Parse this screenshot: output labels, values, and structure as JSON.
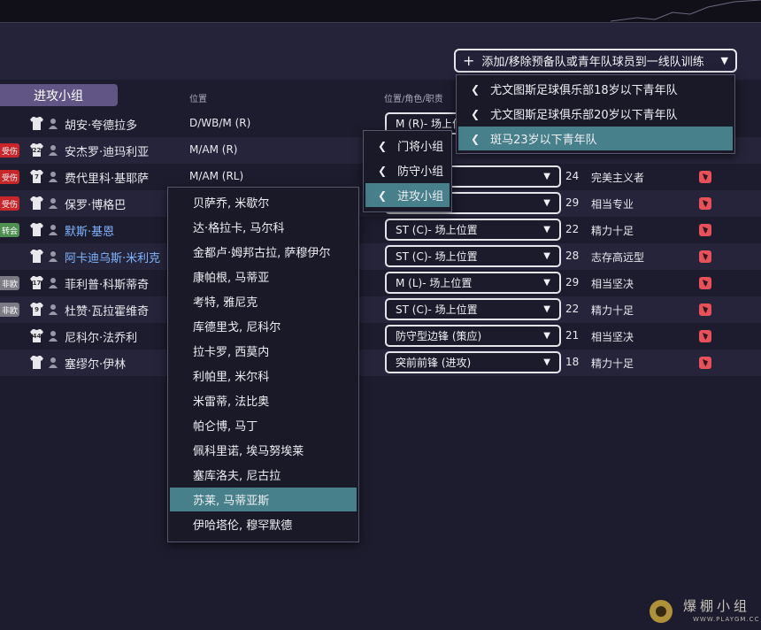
{
  "header": {
    "add_remove_label": "添加/移除预备队或青年队球员到一线队训练"
  },
  "group_tab": "进攻小组",
  "columns": {
    "position": "位置",
    "role_duty": "位置/角色/职责"
  },
  "players": [
    {
      "tag": "",
      "shirt": "",
      "name": "胡安·夸德拉多",
      "pos": "D/WB/M (R)",
      "role": "M (R)- 场上位置",
      "age": "",
      "trait": ""
    },
    {
      "tag": "受伤",
      "shirt": "22",
      "name": "安杰罗·迪玛利亚",
      "pos": "M/AM (R)",
      "role": "",
      "age": "",
      "trait": ""
    },
    {
      "tag": "受伤",
      "shirt": "7",
      "name": "费代里科·基耶萨",
      "pos": "M/AM (RL)",
      "role": "- 场上位置",
      "age": "24",
      "trait": "完美主义者"
    },
    {
      "tag": "受伤",
      "shirt": "",
      "name": "保罗·博格巴",
      "pos": "",
      "role": "上位置",
      "age": "29",
      "trait": "相当专业"
    },
    {
      "tag": "转会",
      "shirt": "",
      "name": "默斯·基恩",
      "pos": "",
      "role": "ST (C)- 场上位置",
      "age": "22",
      "trait": "精力十足"
    },
    {
      "tag": "",
      "shirt": "",
      "name": "阿卡迪乌斯·米利克",
      "pos": "",
      "role": "ST (C)- 场上位置",
      "age": "28",
      "trait": "志存高远型"
    },
    {
      "tag": "非欧",
      "shirt": "17",
      "name": "菲利普·科斯蒂奇",
      "pos": "",
      "role": "M (L)- 场上位置",
      "age": "29",
      "trait": "相当坚决"
    },
    {
      "tag": "非欧",
      "shirt": "9",
      "name": "杜赞·瓦拉霍维奇",
      "pos": "",
      "role": "ST (C)- 场上位置",
      "age": "22",
      "trait": "精力十足"
    },
    {
      "tag": "",
      "shirt": "44",
      "name": "尼科尔·法乔利",
      "pos": "",
      "role": "防守型边锋 (策应)",
      "age": "21",
      "trait": "相当坚决"
    },
    {
      "tag": "",
      "shirt": "",
      "name": "塞缪尔·伊林",
      "pos": "",
      "role": "突前前锋 (进攻)",
      "age": "18",
      "trait": "精力十足"
    }
  ],
  "squad_menu": {
    "items": [
      "尤文图斯足球俱乐部18岁以下青年队",
      "尤文图斯足球俱乐部20岁以下青年队",
      "斑马23岁以下青年队"
    ],
    "selected": 2
  },
  "unit_menu": {
    "items": [
      "门将小组",
      "防守小组",
      "进攻小组"
    ],
    "selected": 2
  },
  "player_menu": {
    "items": [
      "贝萨乔, 米歇尔",
      "达·格拉卡, 马尔科",
      "金都卢·姆邦古拉, 萨穆伊尔",
      "康帕根, 马蒂亚",
      "考特, 雅尼克",
      "库德里戈, 尼科尔",
      "拉卡罗, 西莫内",
      "利帕里, 米尔科",
      "米雷蒂, 法比奥",
      "帕仑博, 马丁",
      "佩科里诺, 埃马努埃莱",
      "塞库洛夫, 尼古拉",
      "苏莱, 马蒂亚斯",
      "伊哈塔伦, 穆罕默德"
    ],
    "selected": 12
  },
  "watermark": {
    "text": "爆棚小组",
    "sub": "WWW.PLAYGM.CC"
  }
}
